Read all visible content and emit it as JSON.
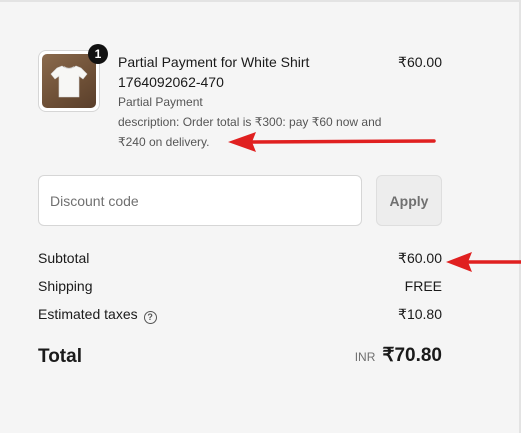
{
  "product": {
    "quantity": "1",
    "title": "Partial Payment for White Shirt",
    "sku": "1764092062-470",
    "variant": "Partial Payment",
    "description": "description: Order total is ₹300: pay ₹60 now and ₹240 on delivery.",
    "price": "₹60.00",
    "image_icon": "tshirt-icon"
  },
  "discount": {
    "placeholder": "Discount code",
    "apply_label": "Apply"
  },
  "summary": {
    "subtotal_label": "Subtotal",
    "subtotal_value": "₹60.00",
    "shipping_label": "Shipping",
    "shipping_value": "FREE",
    "taxes_label": "Estimated taxes",
    "taxes_value": "₹10.80",
    "help_icon": "question-circle-icon"
  },
  "total": {
    "label": "Total",
    "currency": "INR",
    "value": "₹70.80"
  },
  "colors": {
    "background": "#f5f5f5",
    "annotation_arrow": "#e02020",
    "badge": "#111111"
  }
}
